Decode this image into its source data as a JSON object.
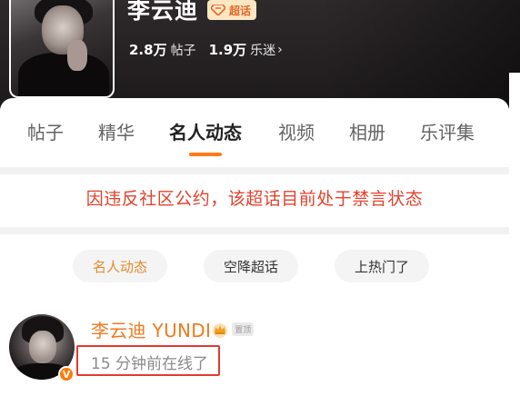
{
  "header": {
    "name": "李云迪",
    "badge_label": "超话",
    "stats": [
      {
        "value": "2.8万",
        "label": "帖子"
      },
      {
        "value": "1.9万",
        "label": "乐迷",
        "chevron": "›"
      }
    ]
  },
  "tabs": [
    {
      "label": "帖子"
    },
    {
      "label": "精华"
    },
    {
      "label": "名人动态",
      "active": true
    },
    {
      "label": "视频"
    },
    {
      "label": "相册"
    },
    {
      "label": "乐评集"
    }
  ],
  "notice": "因违反社区公约，该超话目前处于禁言状态",
  "filters": [
    {
      "label": "名人动态",
      "active": true
    },
    {
      "label": "空降超话"
    },
    {
      "label": "上热门了"
    }
  ],
  "post": {
    "username": "李云迪 YUNDI",
    "tag": "置顶",
    "status": "15 分钟前在线了",
    "verified_mark": "V"
  },
  "colors": {
    "accent": "#ff7a1a",
    "notice": "#e2432e",
    "username": "#f07a20",
    "highlight_box": "#e33b2e"
  }
}
